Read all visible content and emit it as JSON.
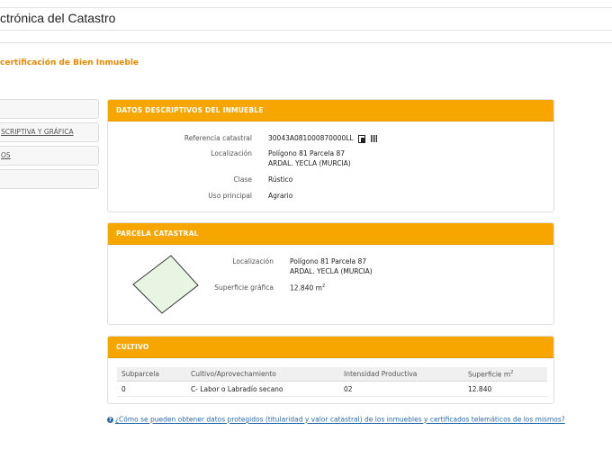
{
  "header": {
    "title": "ctrónica del Catastro"
  },
  "page": {
    "subtitle": "certificación de Bien Inmueble"
  },
  "sidebar": {
    "items": [
      "",
      "SCRIPTIVA Y GRÁFICA",
      "OS",
      ""
    ]
  },
  "datos": {
    "heading": "DATOS DESCRIPTIVOS DEL INMUEBLE",
    "ref_label": "Referencia catastral",
    "ref_value": "30043A081000870000LL",
    "loc_label": "Localización",
    "loc_line1": "Polígono 81 Parcela 87",
    "loc_line2": "ARDAL. YECLA (MURCIA)",
    "clase_label": "Clase",
    "clase_value": "Rústico",
    "uso_label": "Uso principal",
    "uso_value": "Agrario",
    "icons": [
      "copy-icon",
      "barcode-icon"
    ]
  },
  "parcela": {
    "heading": "PARCELA CATASTRAL",
    "loc_label": "Localización",
    "loc_line1": "Polígono 81 Parcela 87",
    "loc_line2": "ARDAL. YECLA (MURCIA)",
    "sup_label": "Superficie gráfica",
    "sup_value": "12.840 m",
    "sup_unit_sup": "2",
    "shape_fill": "#e8f5e3",
    "shape_stroke": "#333333"
  },
  "cultivo": {
    "heading": "CULTIVO",
    "columns": [
      "Subparcela",
      "Cultivo/Aprovechamiento",
      "Intensidad Productiva",
      "Superficie m"
    ],
    "col4_sup": "2",
    "rows": [
      [
        "0",
        "C- Labor o Labradío secano",
        "02",
        "12.840"
      ]
    ]
  },
  "help": {
    "icon": "question-icon",
    "text": "¿Cómo se pueden obtener datos protegidos (titularidad y valor catastral) de los inmuebles y certificados telemáticos de los mismos?"
  },
  "colors": {
    "accent": "#f7a600",
    "subtitle": "#e68a00",
    "link": "#2b6aa8"
  }
}
